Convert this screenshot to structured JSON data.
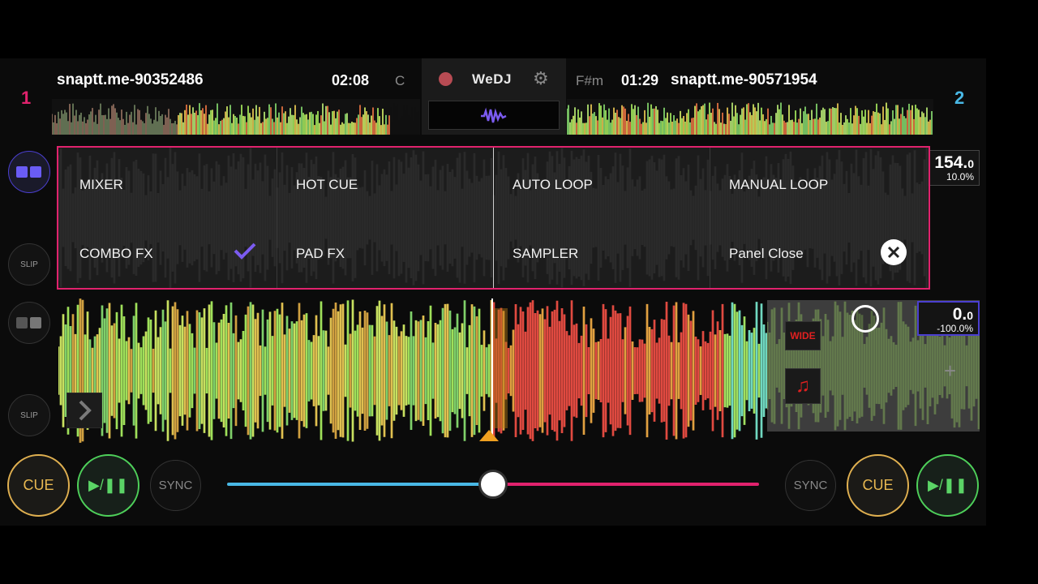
{
  "deck1": {
    "number": "1",
    "track": "snaptt.me-90352486",
    "time": "02:08",
    "key": "C",
    "color": "#e0226d"
  },
  "deck2": {
    "number": "2",
    "track": "snaptt.me-90571954",
    "time": "01:29",
    "key": "F#m",
    "color": "#49b8e5"
  },
  "center": {
    "logo": "WeDJ"
  },
  "side": {
    "slip_top": "SLIP",
    "slip_bottom": "SLIP"
  },
  "panel_menu": {
    "items": [
      {
        "label": "MIXER"
      },
      {
        "label": "HOT CUE"
      },
      {
        "label": "AUTO LOOP"
      },
      {
        "label": "MANUAL LOOP"
      },
      {
        "label": "COMBO FX",
        "selected": true
      },
      {
        "label": "PAD FX"
      },
      {
        "label": "SAMPLER"
      },
      {
        "label": "Panel Close"
      }
    ],
    "border_color": "#e0226d",
    "check_color": "#7b5bf0"
  },
  "bpm_top": {
    "value": "154.",
    "decimal": "0",
    "pct": "10.0%"
  },
  "bpm_bottom": {
    "value": "0.",
    "decimal": "0",
    "pct": "-100.0%"
  },
  "fx": {
    "wide_label": "WIDE"
  },
  "transport": {
    "left": {
      "cue": "CUE",
      "play": "▶/❚❚",
      "sync": "SYNC"
    },
    "right": {
      "cue": "CUE",
      "play": "▶/❚❚",
      "sync": "SYNC"
    }
  },
  "crossfader": {
    "position": 0.5,
    "left_color": "#49b8e5",
    "right_color": "#e0226d"
  }
}
